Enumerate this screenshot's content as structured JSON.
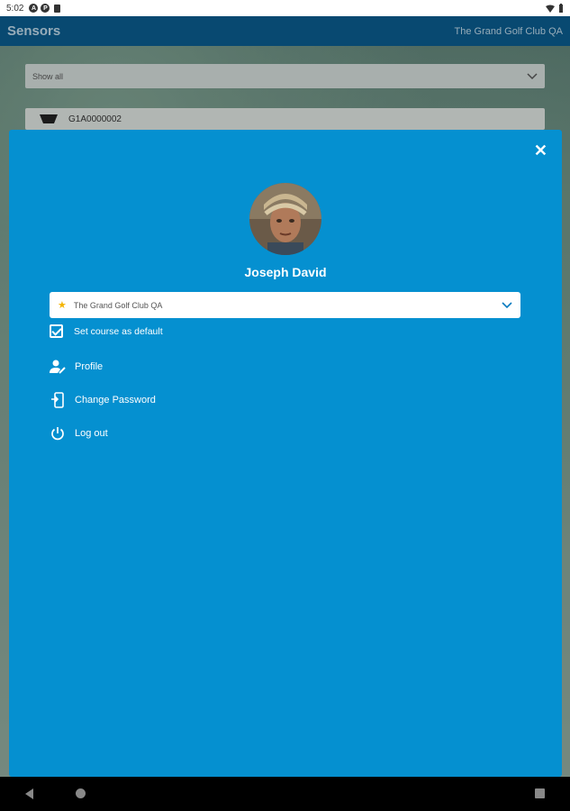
{
  "status_bar": {
    "time": "5:02",
    "icons": [
      "alert-icon",
      "p-icon",
      "battery-saver-icon"
    ],
    "right_icons": [
      "wifi-icon",
      "battery-icon"
    ]
  },
  "app_bar": {
    "title": "Sensors",
    "course": "The Grand Golf Club QA"
  },
  "background": {
    "filter_label": "Show all",
    "sensor_id": "G1A0000002"
  },
  "modal": {
    "close_label": "✕",
    "user_name": "Joseph David",
    "course_select": {
      "value": "The Grand Golf Club QA",
      "icon": "star-icon"
    },
    "set_default": {
      "label": "Set course as default",
      "checked": true
    },
    "menu": [
      {
        "label": "Profile",
        "icon": "profile-icon"
      },
      {
        "label": "Change Password",
        "icon": "change-password-icon"
      },
      {
        "label": "Log out",
        "icon": "power-icon"
      }
    ]
  },
  "colors": {
    "modal_bg": "#0590d0",
    "app_bar": "#0a5a8a",
    "star": "#f4b400"
  }
}
